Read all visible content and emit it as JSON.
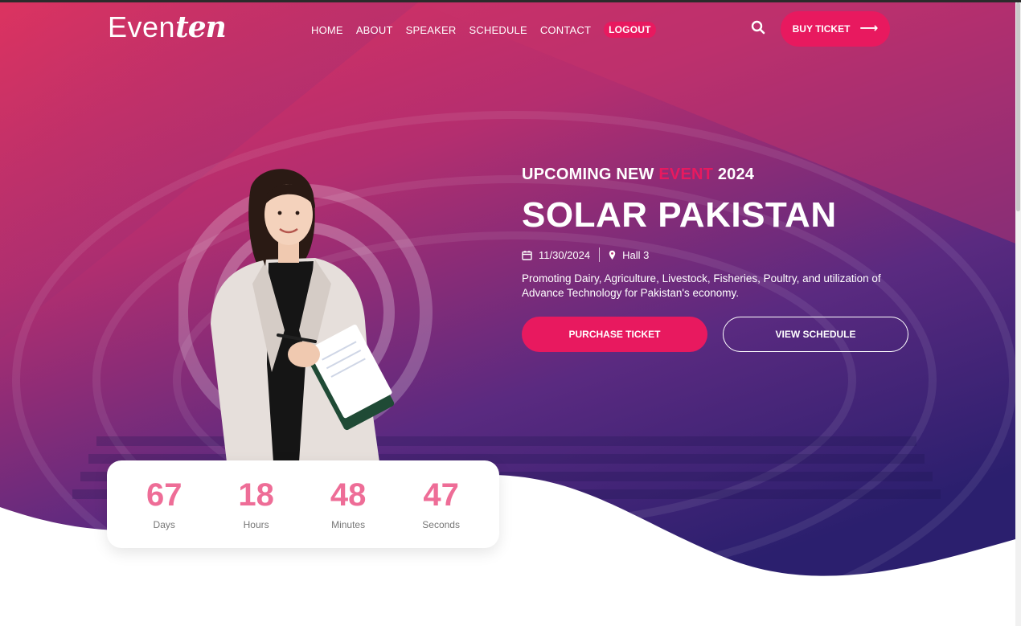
{
  "brand": {
    "logo_part1": "Even",
    "logo_part2": "ten"
  },
  "nav": {
    "items": [
      "HOME",
      "ABOUT",
      "SPEAKER",
      "SCHEDULE",
      "CONTACT"
    ],
    "logout": "LOGOUT"
  },
  "header": {
    "buy_ticket": "BUY TICKET",
    "search_icon": "search-icon",
    "arrow_icon": "arrow-right-icon"
  },
  "hero": {
    "headline_pre": "UPCOMING NEW ",
    "headline_accent": "EVENT",
    "headline_post": " 2024",
    "title": "SOLAR PAKISTAN",
    "date": "11/30/2024",
    "location": "Hall 3",
    "description": "Promoting Dairy, Agriculture, Livestock, Fisheries, Poultry, and utilization of Advance Technology for Pakistan's economy.",
    "purchase_button": "PURCHASE TICKET",
    "schedule_button": "VIEW SCHEDULE"
  },
  "countdown": [
    {
      "value": "67",
      "label": "Days"
    },
    {
      "value": "18",
      "label": "Hours"
    },
    {
      "value": "48",
      "label": "Minutes"
    },
    {
      "value": "47",
      "label": "Seconds"
    }
  ],
  "colors": {
    "accent": "#e8195f",
    "gradient_top": "#d8285e",
    "gradient_bottom": "#2b1f6e",
    "count_number": "#ee6d97"
  }
}
